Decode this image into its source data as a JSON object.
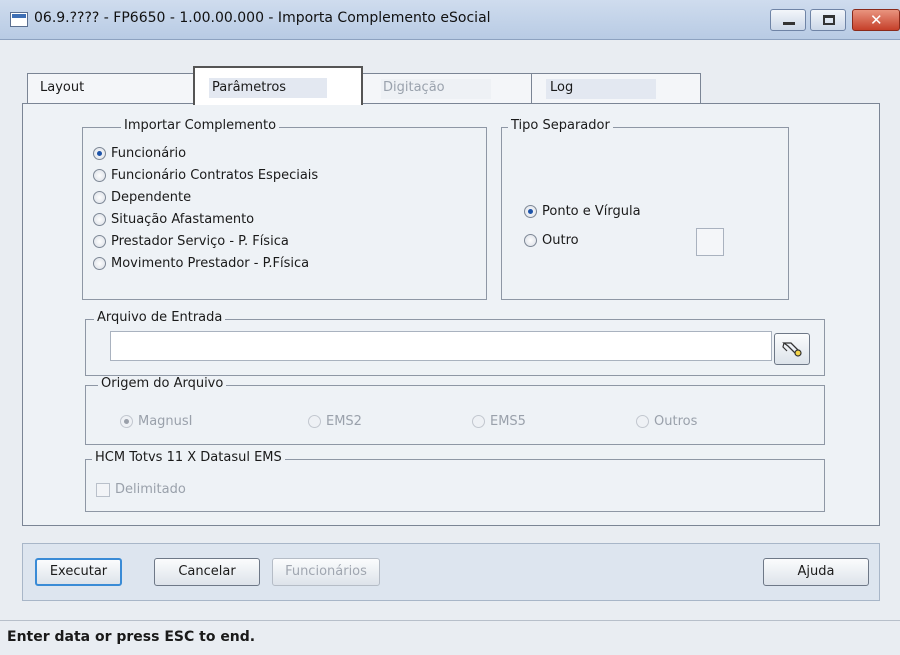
{
  "window": {
    "title": "06.9.???? - FP6650 - 1.00.00.000 - Importa Complemento eSocial"
  },
  "tabs": [
    {
      "label": "Layout",
      "active": false,
      "enabled": true
    },
    {
      "label": "Parâmetros",
      "active": true,
      "enabled": true
    },
    {
      "label": "Digitação",
      "active": false,
      "enabled": false
    },
    {
      "label": "Log",
      "active": false,
      "enabled": true
    }
  ],
  "importar": {
    "label": "Importar Complemento",
    "options": [
      {
        "label": "Funcionário",
        "selected": true
      },
      {
        "label": "Funcionário Contratos Especiais",
        "selected": false
      },
      {
        "label": "Dependente",
        "selected": false
      },
      {
        "label": "Situação Afastamento",
        "selected": false
      },
      {
        "label": "Prestador Serviço - P. Física",
        "selected": false
      },
      {
        "label": "Movimento Prestador - P.Física",
        "selected": false
      }
    ]
  },
  "separador": {
    "label": "Tipo Separador",
    "options": [
      {
        "label": "Ponto e Vírgula",
        "selected": true
      },
      {
        "label": "Outro",
        "selected": false
      }
    ],
    "outro_value": ""
  },
  "arquivo": {
    "label": "Arquivo de Entrada",
    "value": ""
  },
  "origem": {
    "label": "Origem do Arquivo",
    "options": [
      {
        "label": "MagnusI",
        "selected": true
      },
      {
        "label": "EMS2",
        "selected": false
      },
      {
        "label": "EMS5",
        "selected": false
      },
      {
        "label": "Outros",
        "selected": false
      }
    ]
  },
  "hcm": {
    "label": "HCM Totvs 11 X Datasul EMS",
    "checkbox_label": "Delimitado",
    "checked": false
  },
  "buttons": {
    "executar": "Executar",
    "cancelar": "Cancelar",
    "funcionarios": "Funcionários",
    "ajuda": "Ajuda"
  },
  "status": {
    "text": "Enter data or press ESC to end."
  }
}
